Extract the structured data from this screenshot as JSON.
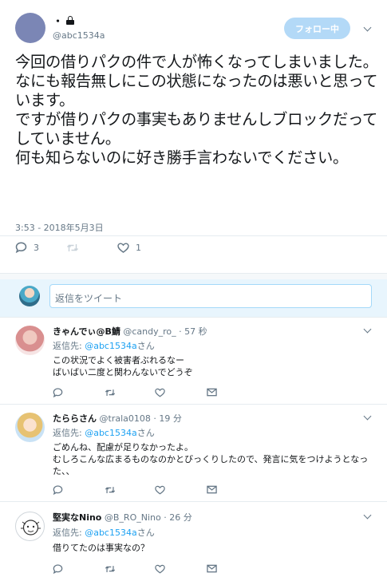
{
  "main_tweet": {
    "display_name": "・",
    "handle": "@abc1534a",
    "follow_button_label": "フォロー中",
    "text": "今回の借りパクの件で人が怖くなってしまいました。\nなにも報告無しにこの状態になったのは悪いと思っています。\nですが借りパクの事実もありませんしブロックだってしていません。\n何も知らないのに好き勝手言わないでください。",
    "timestamp": "3:53 - 2018年5月3日",
    "reply_count": "3",
    "like_count": "1"
  },
  "reply_composer": {
    "placeholder": "返信をツイート"
  },
  "replies": [
    {
      "display_name": "きゃんでぃ@B鯖",
      "handle": "@candy_ro_",
      "time": "57 秒",
      "reply_to_prefix": "返信先: ",
      "reply_to_handle": "@abc1534a",
      "reply_to_suffix": "さん",
      "text": "この状況でよく被害者ぶれるなー\nばいばい二度と関わんないでどうぞ"
    },
    {
      "display_name": "たららさん",
      "handle": "@trala0108",
      "time": "19 分",
      "reply_to_prefix": "返信先: ",
      "reply_to_handle": "@abc1534a",
      "reply_to_suffix": "さん",
      "text": "ごめんね、配慮が足りなかったよ。\nむしろこんな広まるものなのかとびっくりしたので、発言に気をつけようとなった、、"
    },
    {
      "display_name": "堅実なNino",
      "handle": "@B_RO_Nino",
      "time": "26 分",
      "reply_to_prefix": "返信先: ",
      "reply_to_handle": "@abc1534a",
      "reply_to_suffix": "さん",
      "text": "借りてたのは事実なの？"
    }
  ],
  "colors": {
    "accent": "#1da1f2",
    "muted": "#657786",
    "follow_button": "#b3d9f7",
    "composer_bg": "#e8f5fd"
  }
}
